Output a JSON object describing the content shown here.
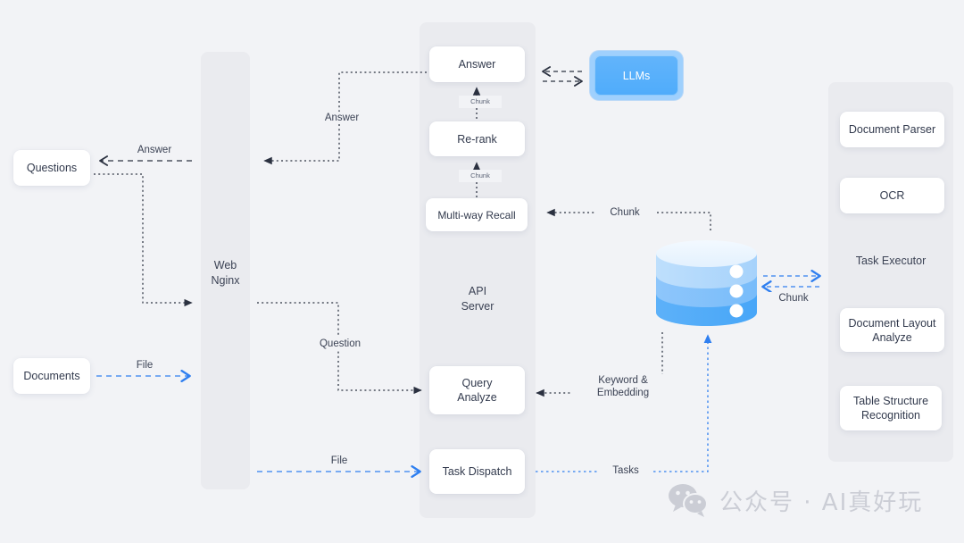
{
  "panels": [
    {
      "id": "web",
      "label": "Web\nNginx"
    },
    {
      "id": "api",
      "label": "API\nServer"
    },
    {
      "id": "exec",
      "label": "Task Executor"
    }
  ],
  "cards": {
    "questions": "Questions",
    "documents": "Documents",
    "answer": "Answer",
    "rerank": "Re-rank",
    "multiway_recall": "Multi-way Recall",
    "query_analyze": "Query\nAnalyze",
    "task_dispatch": "Task Dispatch",
    "document_parser": "Document Parser",
    "ocr": "OCR",
    "document_layout_analyze": "Document Layout\nAnalyze",
    "table_structure_recognition": "Table Structure\nRecognition"
  },
  "llms": {
    "label": "LLMs"
  },
  "database": {
    "name": "vector-database-cylinder"
  },
  "edges": [
    {
      "id": "answer_to_questions",
      "label": "Answer",
      "style": "dashed-dark"
    },
    {
      "id": "answer_from_api",
      "label": "Answer",
      "style": "dotted-dark"
    },
    {
      "id": "question_to_api",
      "label": "Question",
      "style": "dotted-dark"
    },
    {
      "id": "file_documents",
      "label": "File",
      "style": "dashed-blue"
    },
    {
      "id": "file_dispatch",
      "label": "File",
      "style": "dashed-blue"
    },
    {
      "id": "chunk_rerank_to_answer",
      "label": "Chunk",
      "style": "dotted-dark"
    },
    {
      "id": "chunk_recall_to_rerank",
      "label": "Chunk",
      "style": "dotted-dark"
    },
    {
      "id": "chunk_db_to_recall",
      "label": "Chunk",
      "style": "dotted-dark"
    },
    {
      "id": "chunk_db_executor",
      "label": "Chunk",
      "style": "dashed-blue"
    },
    {
      "id": "keyword_embedding",
      "label": "Keyword &\nEmbedding",
      "style": "dotted-dark"
    },
    {
      "id": "tasks",
      "label": "Tasks",
      "style": "dotted-blue"
    },
    {
      "id": "llms_api",
      "label": "",
      "style": "dashed-dark"
    }
  ],
  "watermark": {
    "text": "公众号 · AI真好玩",
    "icon": "wechat-icon"
  },
  "colors": {
    "background": "#f2f3f6",
    "panel": "#eaebef",
    "card": "#ffffff",
    "accent_blue": "#4facfb",
    "llm_blue": "#62b4fb",
    "edge_dark": "#2b3140",
    "edge_blue": "#2f7ff0",
    "text": "#323a4d",
    "watermark": "#c9ccd4"
  }
}
